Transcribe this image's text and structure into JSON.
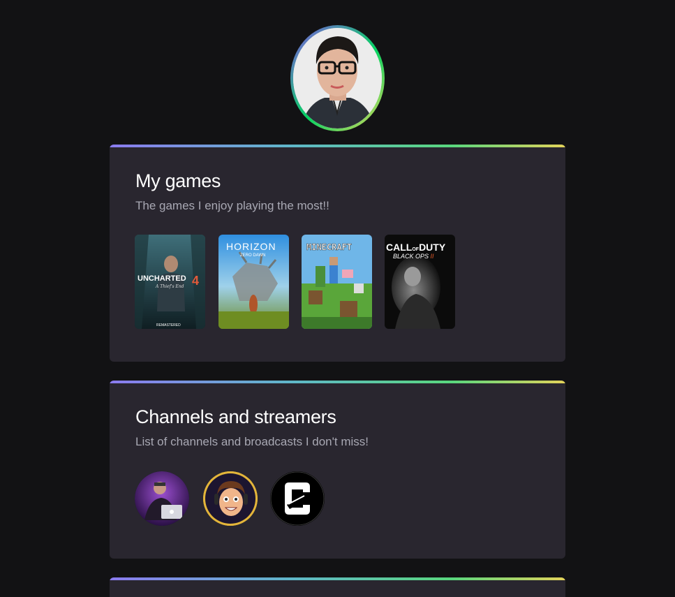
{
  "profile": {
    "avatar_name": "profile-photo"
  },
  "games_section": {
    "title": "My games",
    "subtitle": "The games I enjoy playing the most!!",
    "games": [
      {
        "name": "Uncharted 4",
        "cover_title": "UNCHARTED",
        "cover_sub": "A Thief's End",
        "cover_badge": "REMASTERED",
        "accent": "#2a4a55"
      },
      {
        "name": "Horizon Zero Dawn",
        "cover_title": "HORIZON",
        "cover_sub": "ZERO DAWN",
        "accent": "#3a8fd0"
      },
      {
        "name": "Minecraft",
        "cover_title": "MINECRAFT",
        "accent": "#5aa63a"
      },
      {
        "name": "Call of Duty Black Ops II",
        "cover_title": "CALL OF DUTY",
        "cover_sub": "BLACK OPS II",
        "accent": "#1a1a1a"
      }
    ]
  },
  "channels_section": {
    "title": "Channels and streamers",
    "subtitle": "List of channels and broadcasts I don't miss!",
    "channels": [
      {
        "name": "streamer-1",
        "accent": "#5b2a8a"
      },
      {
        "name": "streamer-2",
        "accent": "#e3b53a"
      },
      {
        "name": "streamer-3",
        "accent": "#000000"
      }
    ]
  },
  "colors": {
    "background": "#121214",
    "card": "#29262f",
    "gradient": [
      "#8b7bf0",
      "#5fb7c9",
      "#59d77e",
      "#e3d35a"
    ]
  }
}
